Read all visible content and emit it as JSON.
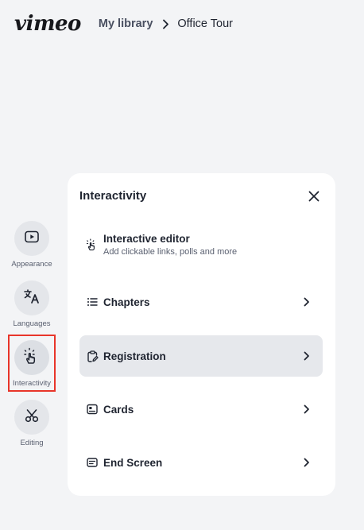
{
  "header": {
    "logo": "vimeo",
    "breadcrumb": {
      "library": "My library",
      "current": "Office Tour"
    }
  },
  "rail": {
    "items": [
      {
        "label": "Appearance",
        "icon": "play-icon"
      },
      {
        "label": "Languages",
        "icon": "translate-icon"
      },
      {
        "label": "Interactivity",
        "icon": "tap-icon"
      },
      {
        "label": "Editing",
        "icon": "scissors-icon"
      }
    ],
    "active": "Interactivity",
    "highlight_color": "#e8352a"
  },
  "panel": {
    "title": "Interactivity",
    "items": [
      {
        "label": "Interactive editor",
        "sub": "Add clickable links, polls and more",
        "icon": "tap-icon"
      },
      {
        "label": "Chapters",
        "icon": "list-icon"
      },
      {
        "label": "Registration",
        "icon": "clipboard-edit-icon"
      },
      {
        "label": "Cards",
        "icon": "card-icon"
      },
      {
        "label": "End Screen",
        "icon": "end-screen-icon"
      }
    ],
    "selected": "Registration"
  }
}
